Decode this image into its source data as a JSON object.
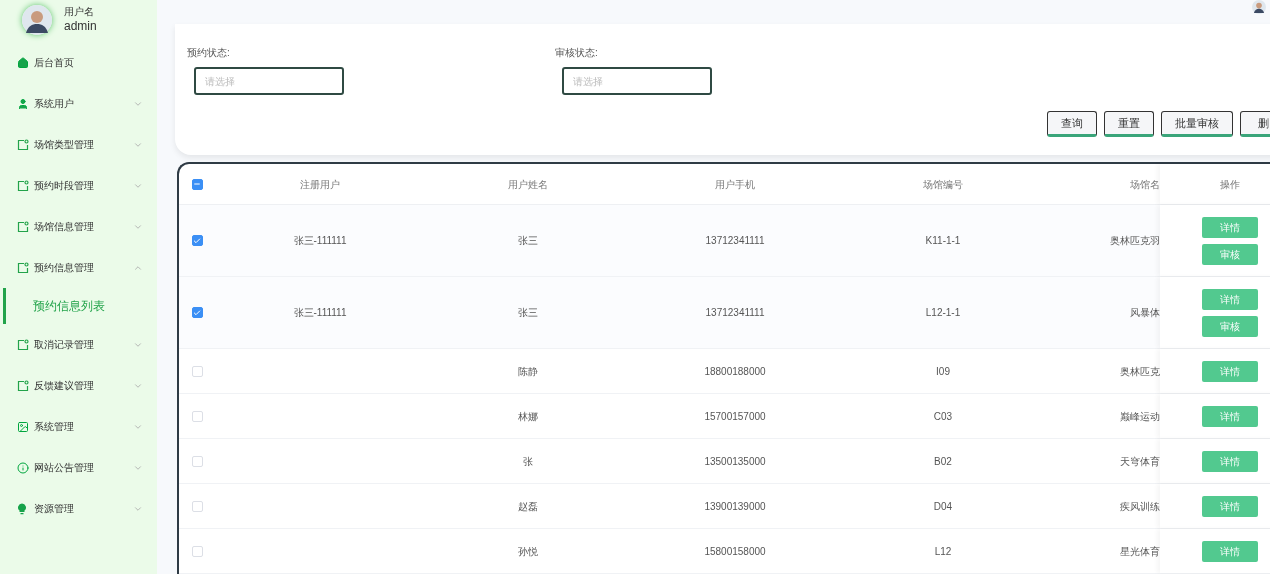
{
  "user": {
    "caption": "用户名",
    "name": "admin"
  },
  "sidebar": {
    "items": [
      {
        "label": "后台首页",
        "kind": "home",
        "has_arrow": false
      },
      {
        "label": "系统用户",
        "kind": "user",
        "expanded": false,
        "has_arrow": true
      },
      {
        "label": "场馆类型管理",
        "kind": "note",
        "expanded": false,
        "has_arrow": true
      },
      {
        "label": "预约时段管理",
        "kind": "note",
        "expanded": false,
        "has_arrow": true
      },
      {
        "label": "场馆信息管理",
        "kind": "note",
        "expanded": false,
        "has_arrow": true
      },
      {
        "label": "预约信息管理",
        "kind": "note",
        "expanded": true,
        "has_arrow": true,
        "children": [
          {
            "label": "预约信息列表",
            "selected": true
          }
        ]
      },
      {
        "label": "取消记录管理",
        "kind": "note",
        "expanded": false,
        "has_arrow": true
      },
      {
        "label": "反馈建议管理",
        "kind": "note",
        "expanded": false,
        "has_arrow": true
      },
      {
        "label": "系统管理",
        "kind": "image",
        "expanded": false,
        "has_arrow": true
      },
      {
        "label": "网站公告管理",
        "kind": "info",
        "expanded": false,
        "has_arrow": true
      },
      {
        "label": "资源管理",
        "kind": "bulb",
        "expanded": false,
        "has_arrow": true
      }
    ]
  },
  "filters": [
    {
      "label": "预约状态:",
      "placeholder": "请选择"
    },
    {
      "label": "审核状态:",
      "placeholder": "请选择"
    }
  ],
  "actions": [
    "查询",
    "重置",
    "批量审核",
    "删"
  ],
  "table": {
    "select_all": {
      "indeterminate": true
    },
    "columns": [
      "注册用户",
      "用户姓名",
      "用户手机",
      "场馆编号",
      "场馆名",
      "操作"
    ],
    "rows": [
      {
        "checked": true,
        "cells": [
          "张三-111111",
          "张三",
          "13712341111",
          "K11-1-1",
          "奥林匹克羽"
        ],
        "buttons": [
          "详情",
          "审核"
        ]
      },
      {
        "checked": true,
        "cells": [
          "张三-111111",
          "张三",
          "13712341111",
          "L12-1-1",
          "风暴体"
        ],
        "buttons": [
          "详情",
          "审核"
        ]
      },
      {
        "checked": false,
        "cells": [
          "",
          "陈静",
          "18800188000",
          "I09",
          "奥林匹克"
        ],
        "buttons": [
          "详情"
        ]
      },
      {
        "checked": false,
        "cells": [
          "",
          "林娜",
          "15700157000",
          "C03",
          "巅峰运动"
        ],
        "buttons": [
          "详情"
        ]
      },
      {
        "checked": false,
        "cells": [
          "",
          "张",
          "13500135000",
          "B02",
          "天穹体育"
        ],
        "buttons": [
          "详情"
        ]
      },
      {
        "checked": false,
        "cells": [
          "",
          "赵磊",
          "13900139000",
          "D04",
          "疾风训练"
        ],
        "buttons": [
          "详情"
        ]
      },
      {
        "checked": false,
        "cells": [
          "",
          "孙悦",
          "15800158000",
          "L12",
          "星光体育"
        ],
        "buttons": [
          "详情"
        ]
      }
    ]
  }
}
